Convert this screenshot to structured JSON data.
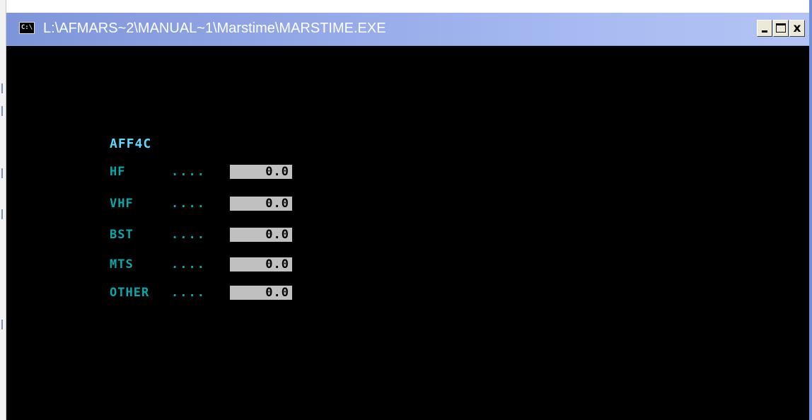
{
  "window": {
    "title": "L:\\AFMARS~2\\MANUAL~1\\Marstime\\MARSTIME.EXE",
    "app_icon": "C:\\",
    "buttons": {
      "minimize_icon": "minimize-icon",
      "maximize_icon": "maximize-icon",
      "close_label": "x"
    }
  },
  "console": {
    "heading": "AFF4C",
    "colors": {
      "heading": "#5fd7ff",
      "label": "#0aa8a8",
      "field_bg": "#c0c0c0",
      "background": "#000000"
    },
    "rows": [
      {
        "label": "HF",
        "dots": "....",
        "value": "0.0"
      },
      {
        "label": "VHF",
        "dots": "....",
        "value": "0.0"
      },
      {
        "label": "BST",
        "dots": "....",
        "value": "0.0"
      },
      {
        "label": "MTS",
        "dots": "....",
        "value": "0.0"
      },
      {
        "label": "OTHER",
        "dots": "....",
        "value": "0.0"
      }
    ]
  }
}
